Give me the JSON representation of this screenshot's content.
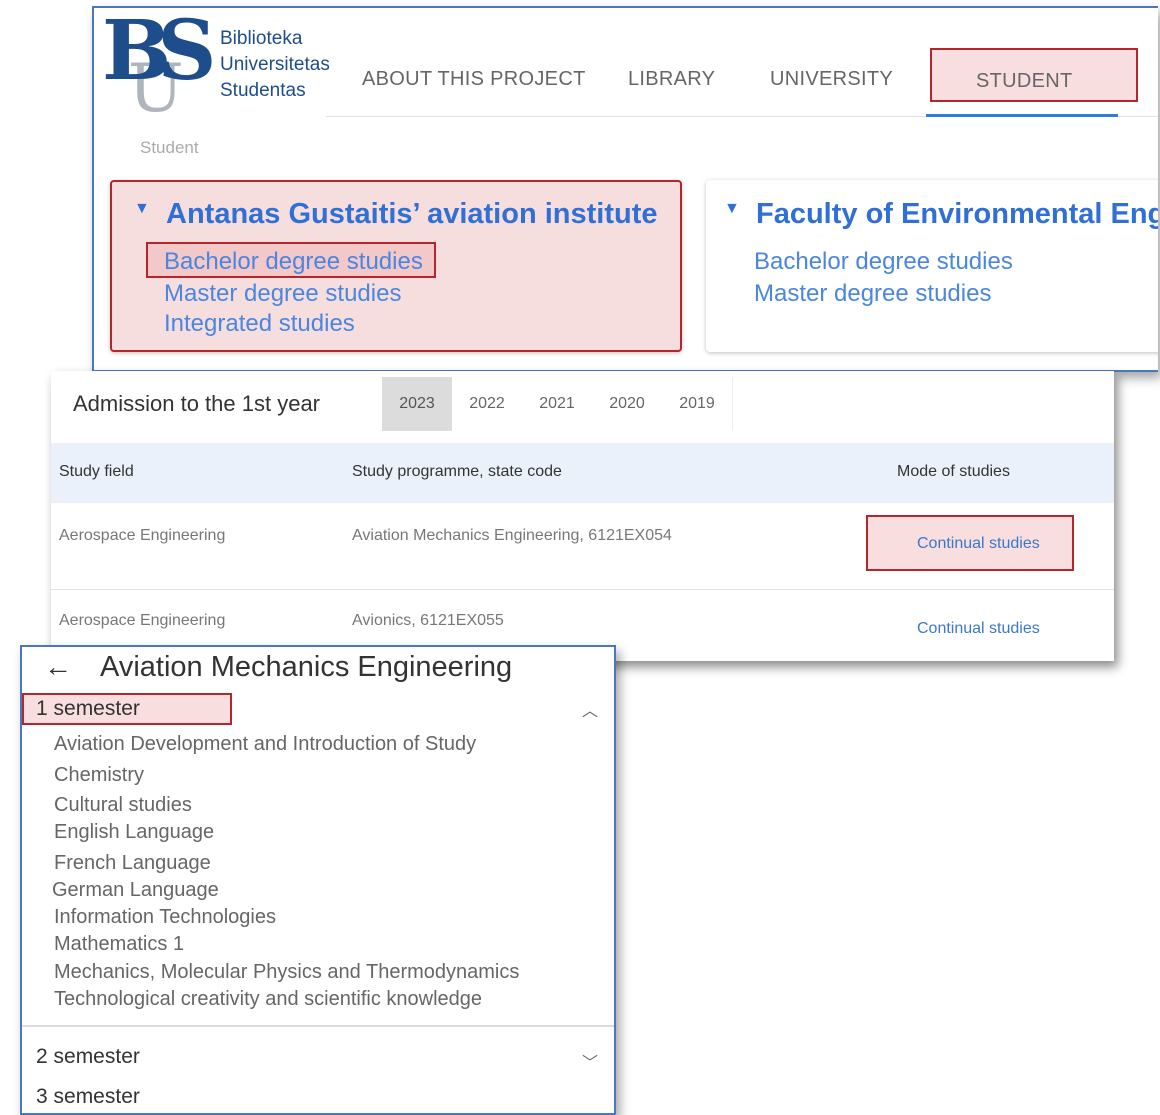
{
  "site": {
    "logo_lines": [
      "Biblioteka",
      "Universitetas",
      "Studentas"
    ],
    "logo_mark": "BS",
    "logo_mark_u": "U",
    "nav": [
      "ABOUT THIS PROJECT",
      "LIBRARY",
      "UNIVERSITY",
      "STUDENT"
    ],
    "active_nav": "STUDENT",
    "breadcrumb": "Student"
  },
  "faculties": [
    {
      "title": "Antanas Gustaitis’ aviation institute",
      "links": [
        "Bachelor degree studies",
        "Master degree studies",
        "Integrated studies"
      ]
    },
    {
      "title": "Faculty of Environmental Eng",
      "links": [
        "Bachelor degree studies",
        "Master degree studies"
      ]
    }
  ],
  "admission": {
    "title": "Admission to the 1st year",
    "years": [
      "2023",
      "2022",
      "2021",
      "2020",
      "2019"
    ],
    "active_year": "2023",
    "columns": [
      "Study field",
      "Study programme, state code",
      "Mode of studies"
    ],
    "rows": [
      {
        "field": "Aerospace Engineering",
        "programme": "Aviation Mechanics Engineering, 6121EX054",
        "mode": "Continual studies"
      },
      {
        "field": "Aerospace Engineering",
        "programme": "Avionics, 6121EX055",
        "mode": "Continual studies"
      }
    ]
  },
  "programme": {
    "title": "Aviation Mechanics Engineering",
    "back_icon": "arrow-left-icon",
    "semesters": [
      "1 semester",
      "2 semester",
      "3 semester"
    ],
    "semester1_courses": [
      "Aviation Development and Introduction of Study",
      "Chemistry",
      "Cultural studies",
      "English Language",
      "French Language",
      "German Language",
      "Information Technologies",
      "Mathematics 1",
      "Mechanics, Molecular Physics and Thermodynamics",
      "Technological creativity and scientific knowledge"
    ]
  },
  "colors": {
    "accent": "#2f7de1",
    "highlight_border": "#b3262b",
    "logo_blue": "#1e4d8c"
  }
}
